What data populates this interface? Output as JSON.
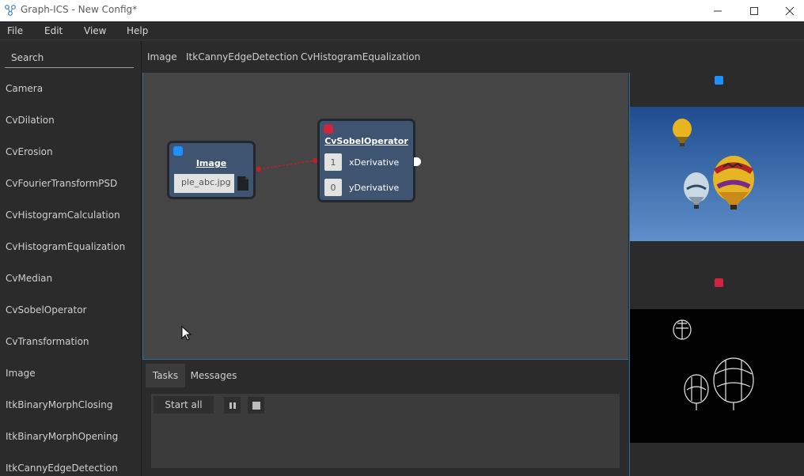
{
  "window": {
    "title": "Graph-ICS - New Config*",
    "controls": [
      "minimize-icon",
      "maximize-icon",
      "close-icon"
    ]
  },
  "menu": [
    "File",
    "Edit",
    "View",
    "Help"
  ],
  "sidebar": {
    "search_placeholder": "Search",
    "items": [
      "Camera",
      "CvDilation",
      "CvErosion",
      "CvFourierTransformPSD",
      "CvHistogramCalculation",
      "CvHistogramEqualization",
      "CvMedian",
      "CvSobelOperator",
      "CvTransformation",
      "Image",
      "ItkBinaryMorphClosing",
      "ItkBinaryMorphOpening",
      "ItkCannyEdgeDetection"
    ]
  },
  "tabs": [
    "Image",
    "ItkCannyEdgeDetection",
    "CvHistogramEqualization"
  ],
  "nodes": {
    "image": {
      "title": "Image",
      "file_value": "ple_abc.jpg",
      "dot_color": "#1e90ff"
    },
    "sobel": {
      "title": "CvSobelOperator",
      "dot_color": "#d0243c",
      "params": [
        {
          "value": "1",
          "label": "xDerivative"
        },
        {
          "value": "0",
          "label": "yDerivative"
        }
      ]
    }
  },
  "connection_color": "#c0202c",
  "bottom_tabs": [
    "Tasks",
    "Messages"
  ],
  "tasks": {
    "start_all": "Start all"
  },
  "preview": {
    "top_dot_color": "#1e90ff",
    "bottom_dot_color": "#d0243c"
  }
}
